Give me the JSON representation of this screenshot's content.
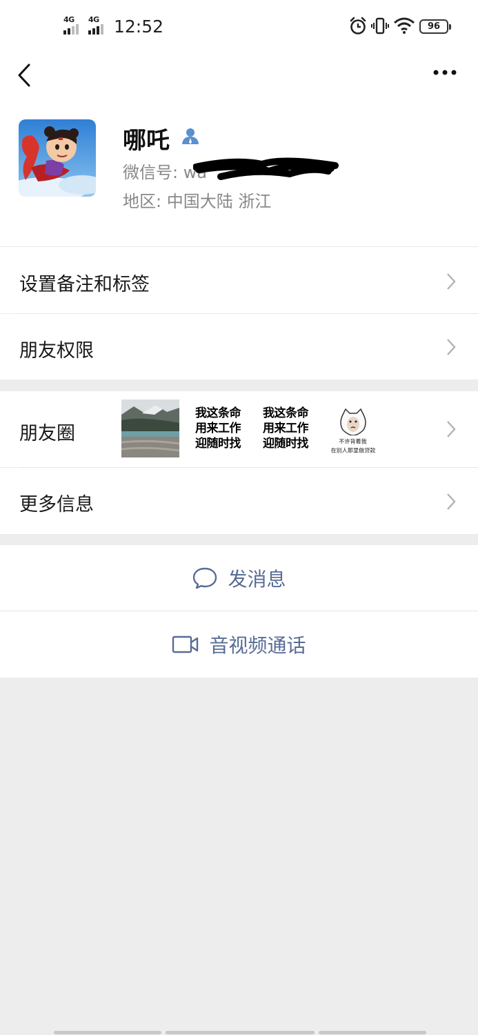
{
  "status_bar": {
    "network_1": "4G",
    "network_2": "4G",
    "time": "12:52",
    "icons": [
      "alarm-icon",
      "vibrate-icon",
      "wifi-icon"
    ],
    "battery": "96"
  },
  "profile": {
    "name": "哪吒",
    "wechat_id_label": "微信号:  wa",
    "region": "地区:  中国大陆  浙江"
  },
  "menu": {
    "set_remark": "设置备注和标签",
    "friend_permissions": "朋友权限",
    "moments": "朋友圈",
    "more_info": "更多信息"
  },
  "moments_thumbs": {
    "meme_line1": "我这条命",
    "meme_line2": "用来工作",
    "meme_line3": "迎随时找",
    "face_caption1": "不许背着我",
    "face_caption2": "在别人那里做贷款"
  },
  "actions": {
    "send_message": "发消息",
    "video_call": "音视频通话"
  },
  "colors": {
    "link_blue": "#576b95",
    "background": "#ededed",
    "card": "#ffffff"
  }
}
